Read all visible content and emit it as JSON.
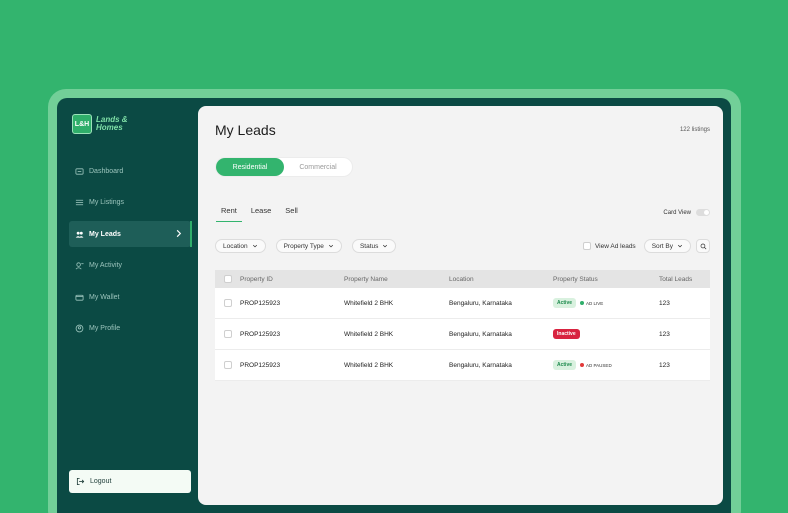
{
  "brand": {
    "mark": "L&H",
    "name_line1": "Lands &",
    "name_line2": "Homes"
  },
  "sidebar": {
    "items": [
      {
        "label": "Dashboard",
        "icon": "dashboard-icon"
      },
      {
        "label": "My Listings",
        "icon": "list-icon"
      },
      {
        "label": "My Leads",
        "icon": "users-icon",
        "active": true
      },
      {
        "label": "My Activity",
        "icon": "activity-icon"
      },
      {
        "label": "My Wallet",
        "icon": "wallet-icon"
      },
      {
        "label": "My Profile",
        "icon": "profile-icon"
      }
    ],
    "logout": "Logout"
  },
  "main": {
    "title": "My Leads",
    "listing_count": "122 listings",
    "segments": [
      "Residential",
      "Commercial"
    ],
    "tabs": [
      "Rent",
      "Lease",
      "Sell"
    ],
    "card_view_label": "Card View",
    "filters": [
      "Location",
      "Property Type",
      "Status"
    ],
    "view_ad_leads": "View Ad leads",
    "sort_by": "Sort By"
  },
  "table": {
    "headers": [
      "Property ID",
      "Property Name",
      "Location",
      "Property Status",
      "Total Leads"
    ],
    "rows": [
      {
        "id": "PROP125923",
        "name": "Whitefield 2 BHK",
        "location": "Bengaluru, Karnataka",
        "status": "Active",
        "ad": "AD LIVE",
        "leads": "123"
      },
      {
        "id": "PROP125923",
        "name": "Whitefield 2 BHK",
        "location": "Bengaluru, Karnataka",
        "status": "Inactive",
        "ad": "",
        "leads": "123"
      },
      {
        "id": "PROP125923",
        "name": "Whitefield 2 BHK",
        "location": "Bengaluru, Karnataka",
        "status": "Active",
        "ad": "AD PAUSED",
        "leads": "123"
      }
    ]
  },
  "colors": {
    "background": "#33b46e",
    "sidebar": "#0b4a44",
    "accent": "#33b46e",
    "inactive": "#d82340",
    "ad_live": "#2fae6a",
    "ad_paused": "#e23a3a"
  }
}
